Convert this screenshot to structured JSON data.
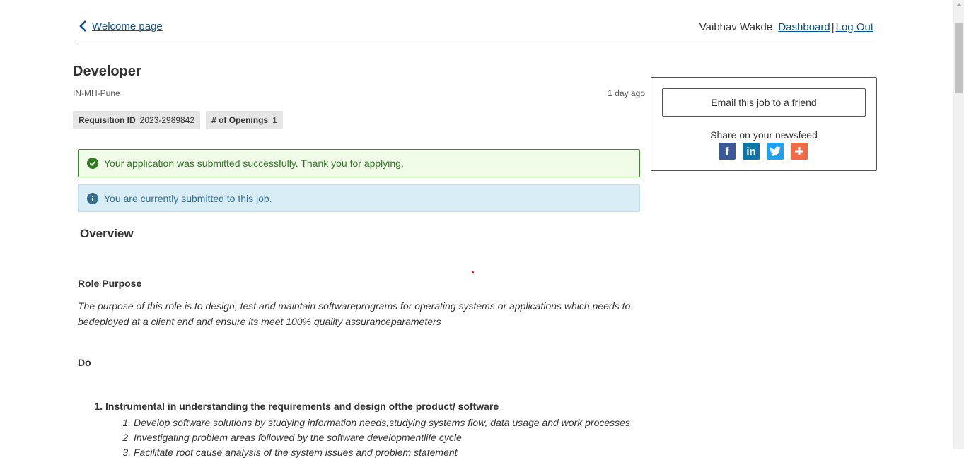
{
  "nav": {
    "back_label": "Welcome page",
    "user_name": "Vaibhav Wakde",
    "dashboard_label": "Dashboard",
    "separator": "|",
    "logout_label": "Log Out"
  },
  "job": {
    "title": "Developer",
    "location": "IN-MH-Pune",
    "posted": "1 day ago",
    "requisition_label": "Requisition ID",
    "requisition_value": "2023-2989842",
    "openings_label": "# of Openings",
    "openings_value": "1"
  },
  "alerts": {
    "success": "Your application was submitted successfully. Thank you for applying.",
    "info": "You are currently submitted to this job."
  },
  "content": {
    "overview_heading": "Overview",
    "role_heading": "Role Purpose",
    "role_text": "The purpose of this role is to design, test and maintain softwareprograms for operating systems or applications which needs to bedeployed at a client end and ensure its meet 100% quality assuranceparameters",
    "do_heading": "Do",
    "list_item_1": "Instrumental in understanding the requirements and design ofthe product/ software",
    "sub_items": [
      "Develop software solutions by studying information needs,studying systems flow, data usage and work processes",
      "Investigating problem areas followed by the software developmentlife cycle",
      "Facilitate root cause analysis of the system issues and problem statement"
    ]
  },
  "sidebar": {
    "email_button": "Email this job to a friend",
    "share_label": "Share on your newsfeed",
    "socials": [
      "facebook-icon",
      "linkedin-icon",
      "twitter-icon",
      "addthis-plus-icon"
    ]
  },
  "colors": {
    "link": "#0b5394",
    "success_border": "#3c8a2e",
    "success_bg": "#f0fbe8",
    "info_bg": "#d9edf7"
  }
}
